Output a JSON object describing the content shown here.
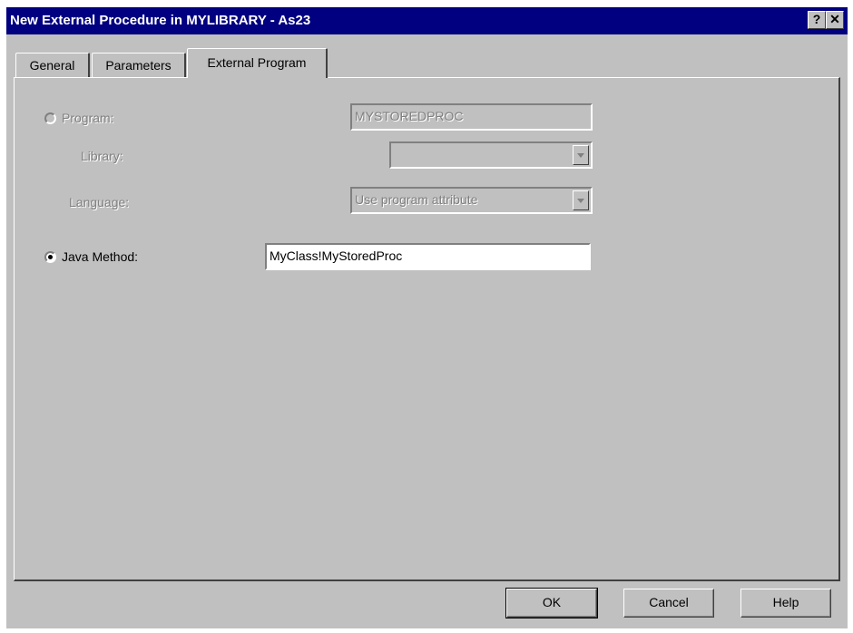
{
  "window": {
    "title": "New External Procedure in MYLIBRARY  - As23",
    "help_glyph": "?",
    "close_glyph": "✕"
  },
  "tabs": [
    {
      "label": "General",
      "active": false
    },
    {
      "label": "Parameters",
      "active": false
    },
    {
      "label": "External Program",
      "active": true
    }
  ],
  "program": {
    "radio_label": "Program:",
    "value": "MYSTOREDPROC",
    "selected": false,
    "enabled": false
  },
  "library": {
    "label": "Library:",
    "value": ""
  },
  "language": {
    "label": "Language:",
    "value": "Use program attribute"
  },
  "java_method": {
    "radio_label": "Java Method:",
    "value": "MyClass!MyStoredProc",
    "selected": true
  },
  "buttons": {
    "ok": "OK",
    "cancel": "Cancel",
    "help": "Help"
  },
  "colors": {
    "title_bar": "#000080",
    "face": "#c0c0c0",
    "disabled_text": "#808080"
  }
}
